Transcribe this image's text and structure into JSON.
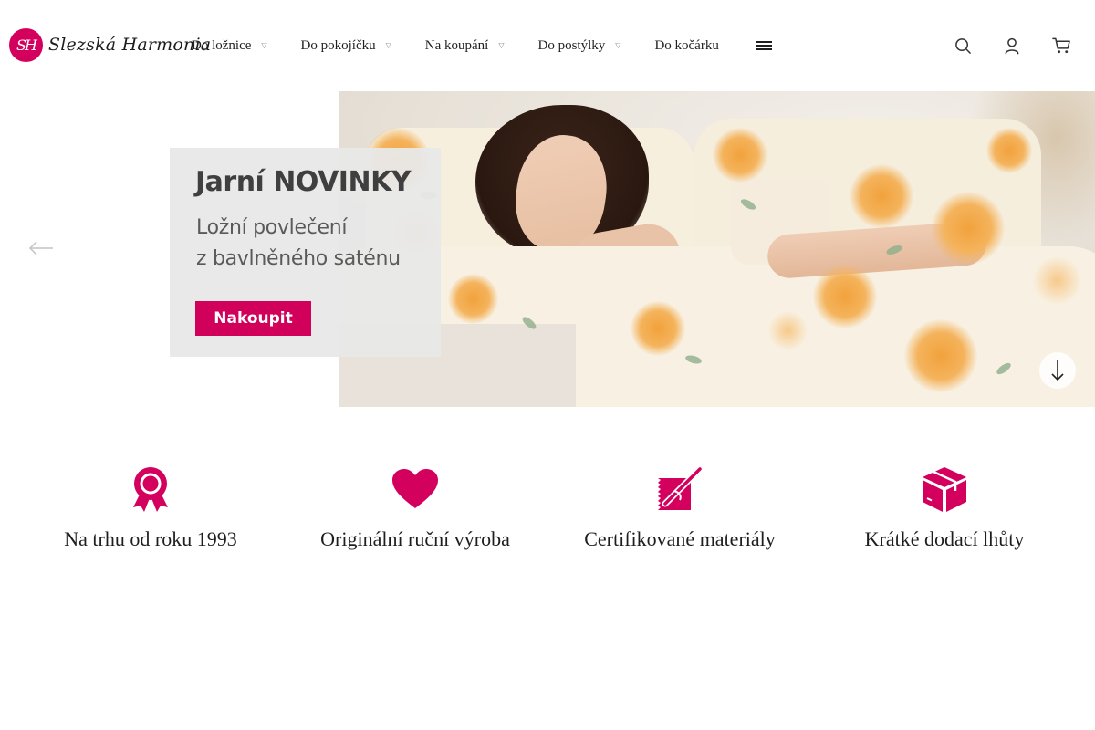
{
  "brand": {
    "badge": "SH",
    "name": "Slezská Harmonia",
    "accent": "#d4005e"
  },
  "nav": {
    "items": [
      {
        "label": "Do ložnice",
        "has_caret": true
      },
      {
        "label": "Do pokojíčku",
        "has_caret": true
      },
      {
        "label": "Na koupání",
        "has_caret": true
      },
      {
        "label": "Do postýlky",
        "has_caret": true
      },
      {
        "label": "Do kočárku",
        "has_caret": false
      }
    ],
    "more_icon": "menu-lines-icon"
  },
  "header_icons": [
    "search-icon",
    "user-icon",
    "cart-icon"
  ],
  "hero": {
    "promo_title": "Jarní NOVINKY",
    "promo_subtitle_line1": "Ložní povlečení",
    "promo_subtitle_line2": "z bavlněného saténu",
    "cta": "Nakoupit",
    "prev_icon": "arrow-left-icon",
    "scroll_icon": "arrow-down-icon"
  },
  "features": [
    {
      "label": "Na trhu od roku 1993",
      "icon": "award-ribbon-icon"
    },
    {
      "label": "Originální ruční výroba",
      "icon": "heart-icon"
    },
    {
      "label": "Certifikované materiály",
      "icon": "fabric-needle-icon"
    },
    {
      "label": "Krátké dodací lhůty",
      "icon": "package-box-icon"
    }
  ]
}
